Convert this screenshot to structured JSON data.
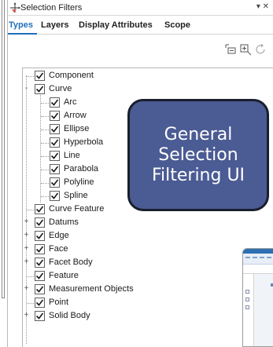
{
  "panel": {
    "title": "Selection Filters",
    "pin_glyph": "▾ ✕"
  },
  "tabs": [
    {
      "label": "Types",
      "active": true
    },
    {
      "label": "Layers",
      "active": false
    },
    {
      "label": "Display Attributes",
      "active": false
    },
    {
      "label": "Scope",
      "active": false
    }
  ],
  "toolbar": {
    "icons": [
      "collapse-all-icon",
      "expand-all-icon",
      "reset-icon"
    ]
  },
  "tree": {
    "items": [
      {
        "label": "Component",
        "checked": true,
        "level": 0,
        "expander": ""
      },
      {
        "label": "Curve",
        "checked": true,
        "level": 0,
        "expander": "-"
      },
      {
        "label": "Arc",
        "checked": true,
        "level": 1,
        "expander": ""
      },
      {
        "label": "Arrow",
        "checked": true,
        "level": 1,
        "expander": ""
      },
      {
        "label": "Ellipse",
        "checked": true,
        "level": 1,
        "expander": ""
      },
      {
        "label": "Hyperbola",
        "checked": true,
        "level": 1,
        "expander": ""
      },
      {
        "label": "Line",
        "checked": true,
        "level": 1,
        "expander": ""
      },
      {
        "label": "Parabola",
        "checked": true,
        "level": 1,
        "expander": ""
      },
      {
        "label": "Polyline",
        "checked": true,
        "level": 1,
        "expander": ""
      },
      {
        "label": "Spline",
        "checked": true,
        "level": 1,
        "expander": ""
      },
      {
        "label": "Curve Feature",
        "checked": true,
        "level": 0,
        "expander": ""
      },
      {
        "label": "Datums",
        "checked": true,
        "level": 0,
        "expander": "+"
      },
      {
        "label": "Edge",
        "checked": true,
        "level": 0,
        "expander": "+"
      },
      {
        "label": "Face",
        "checked": true,
        "level": 0,
        "expander": "+"
      },
      {
        "label": "Facet Body",
        "checked": true,
        "level": 0,
        "expander": "+"
      },
      {
        "label": "Feature",
        "checked": true,
        "level": 0,
        "expander": ""
      },
      {
        "label": "Measurement Objects",
        "checked": true,
        "level": 0,
        "expander": "+"
      },
      {
        "label": "Point",
        "checked": true,
        "level": 0,
        "expander": ""
      },
      {
        "label": "Solid Body",
        "checked": true,
        "level": 0,
        "expander": "+"
      }
    ]
  },
  "callout": {
    "lines": [
      "General",
      "Selection",
      "Filtering UI"
    ],
    "color": "#4b5b93"
  },
  "colors": {
    "accent": "#1f6fb8"
  }
}
